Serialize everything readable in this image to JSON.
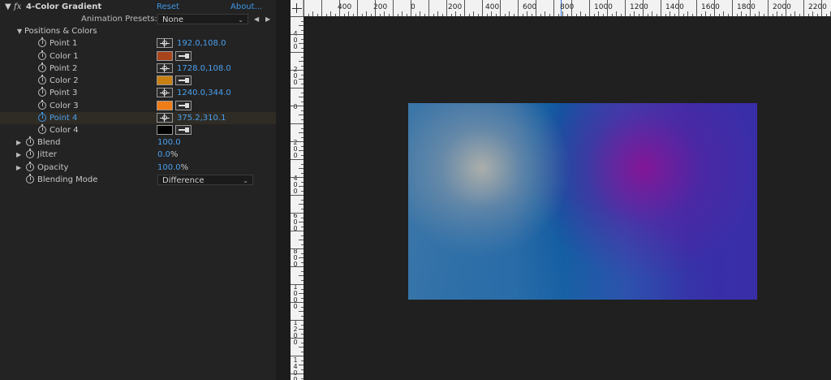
{
  "effect": {
    "title": "4-Color Gradient",
    "fx_label": "fx",
    "reset_label": "Reset",
    "about_label": "About...",
    "animation_presets_label": "Animation Presets:",
    "animation_presets_value": "None",
    "group_label": "Positions & Colors",
    "point1_label": "Point 1",
    "point1_value": "192.0,108.0",
    "color1_label": "Color 1",
    "color1_hex": "#a8441c",
    "point2_label": "Point 2",
    "point2_value": "1728.0,108.0",
    "color2_label": "Color 2",
    "color2_hex": "#c98012",
    "point3_label": "Point 3",
    "point3_value": "1240.0,344.0",
    "color3_label": "Color 3",
    "color3_hex": "#f07d18",
    "point4_label": "Point 4",
    "point4_value": "375.2,310.1",
    "color4_label": "Color 4",
    "color4_hex": "#000000",
    "blend_label": "Blend",
    "blend_value": "100.0",
    "jitter_label": "Jitter",
    "jitter_value": "0.0",
    "jitter_unit": "%",
    "opacity_label": "Opacity",
    "opacity_value": "100.0",
    "opacity_unit": "%",
    "blending_mode_label": "Blending Mode",
    "blending_mode_value": "Difference"
  },
  "ruler": {
    "h_labels": [
      "400",
      "200",
      "0",
      "200",
      "400",
      "600",
      "800",
      "1000",
      "1200",
      "1400",
      "1600",
      "1800",
      "2000",
      "2200"
    ],
    "v_labels": [
      "400",
      "200",
      "0",
      "200",
      "400",
      "600",
      "800",
      "1000",
      "1200",
      "1400"
    ]
  },
  "colors": {
    "accent": "#3c97e8",
    "panel_bg": "#232323",
    "viewer_bg": "#202020"
  }
}
